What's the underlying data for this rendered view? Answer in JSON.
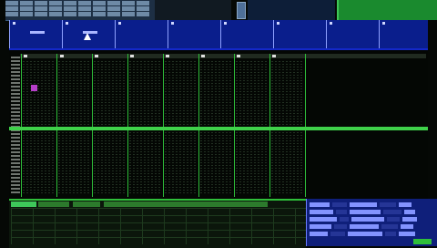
{
  "window": {
    "title": ""
  },
  "menu": {
    "row_count": 3,
    "buttons_per_row": 10
  },
  "patterns": {
    "tab_count": 8,
    "selected_index": 0
  },
  "editor": {
    "track_count": 8,
    "highlighted_row": ""
  },
  "bottom": {
    "tab_count": 4,
    "active_tab": 0
  },
  "colors": {
    "top_green": "#1a8a2e",
    "pattern_strip": "#0a1e8c",
    "track_separator": "#2fbf3a",
    "highlight_row": "#3fd14a",
    "note_mark": "#b63fc9",
    "bottom_right_panel": "#0f1f7a"
  }
}
